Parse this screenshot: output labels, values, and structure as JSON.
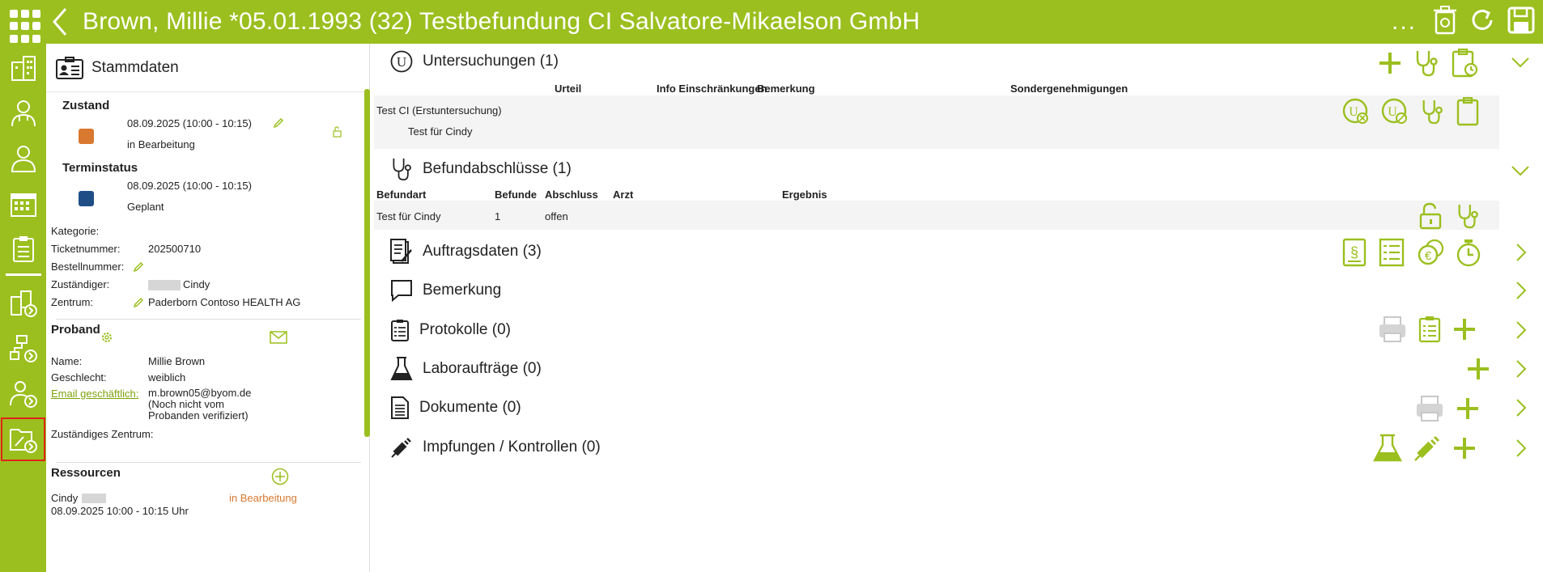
{
  "header": {
    "title": "Brown, Millie *05.01.1993 (32) Testbefundung CI Salvatore-Mikaelson GmbH",
    "more_label": "..."
  },
  "nav": {
    "items": [
      "facility-icon",
      "doctor-icon",
      "person-icon",
      "calendar-icon",
      "checklist-icon",
      "facility-arrow-icon",
      "orgchart-arrow-icon",
      "person-arrow-icon",
      "folder-edit-arrow-icon"
    ]
  },
  "details": {
    "title": "Stammdaten",
    "zustand": {
      "label": "Zustand",
      "date": "08.09.2025 (10:00 - 10:15)",
      "status": "in Bearbeitung",
      "color": "#d9782f"
    },
    "terminstatus": {
      "label": "Terminstatus",
      "date": "08.09.2025 (10:00 - 10:15)",
      "status": "Geplant",
      "color": "#1f4e86"
    },
    "fields": {
      "kategorie_label": "Kategorie:",
      "ticket_label": "Ticketnummer:",
      "ticket_value": "202500710",
      "bestell_label": "Bestellnummer:",
      "zustaendiger_label": "Zuständiger:",
      "zustaendiger_value": "Cindy",
      "zentrum_label": "Zentrum:",
      "zentrum_value": "Paderborn Contoso HEALTH AG"
    },
    "proband": {
      "title": "Proband",
      "name_label": "Name:",
      "name_value": "Millie Brown",
      "gender_label": "Geschlecht:",
      "gender_value": "weiblich",
      "email_label": "Email geschäftlich:",
      "email_value": "m.brown05@byom.de",
      "email_note1": "(Noch nicht vom",
      "email_note2": "Probanden verifiziert)",
      "center_label": "Zuständiges Zentrum:"
    },
    "ressourcen": {
      "title": "Ressourcen",
      "name": "Cindy",
      "status": "in Bearbeitung",
      "time": "08.09.2025 10:00 - 10:15 Uhr"
    }
  },
  "main": {
    "untersuchungen": {
      "title": "Untersuchungen (1)",
      "columns": [
        "Urteil",
        "Info Einschränkungen",
        "Bemerkung",
        "Sondergenehmigungen"
      ],
      "row_title": "Test CI (Erstuntersuchung)",
      "row_sub": "Test für Cindy"
    },
    "befund": {
      "title": "Befundabschlüsse (1)",
      "columns": [
        "Befundart",
        "Befunde",
        "Abschluss",
        "Arzt",
        "Ergebnis"
      ],
      "row": [
        "Test für Cindy",
        "1",
        "offen",
        "",
        ""
      ]
    },
    "auftrag": {
      "title": "Auftragsdaten (3)"
    },
    "bemerkung": {
      "title": "Bemerkung"
    },
    "protokolle": {
      "title": "Protokolle (0)"
    },
    "labor": {
      "title": "Laboraufträge (0)"
    },
    "dokumente": {
      "title": "Dokumente (0)"
    },
    "impfungen": {
      "title": "Impfungen / Kontrollen (0)"
    }
  },
  "colors": {
    "accent": "#9bbf1e",
    "accent_dark": "#7ea20d",
    "grey_icon": "#c8c8c8"
  }
}
